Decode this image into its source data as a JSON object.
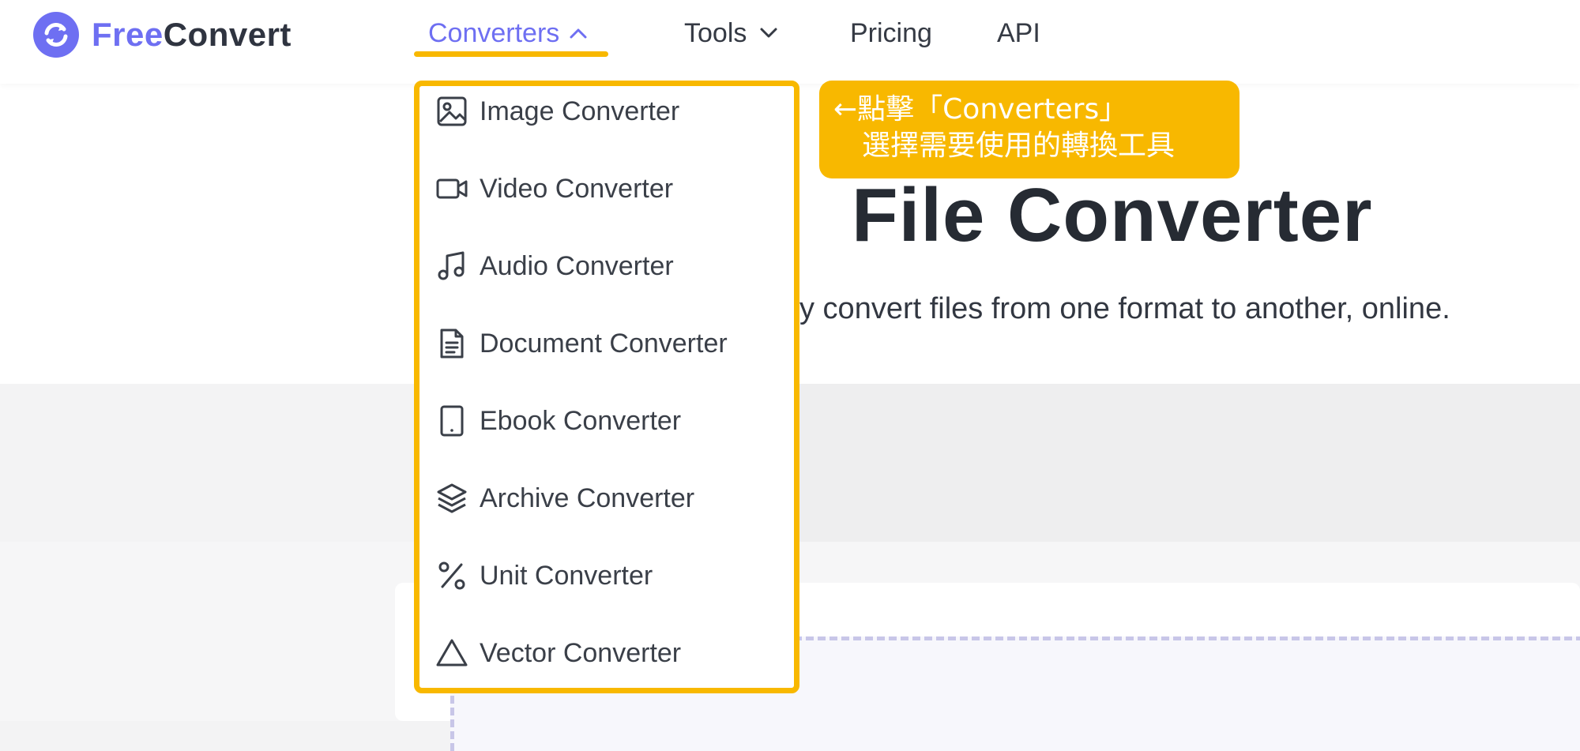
{
  "brand": {
    "free": "Free",
    "convert": "Convert",
    "logo_color": "#6e6ff2"
  },
  "nav": {
    "converters": "Converters",
    "tools": "Tools",
    "pricing": "Pricing",
    "api": "API"
  },
  "dropdown": {
    "items": [
      {
        "label": "Image Converter",
        "icon": "image-icon"
      },
      {
        "label": "Video Converter",
        "icon": "video-icon"
      },
      {
        "label": "Audio Converter",
        "icon": "music-note-icon"
      },
      {
        "label": "Document Converter",
        "icon": "document-icon"
      },
      {
        "label": "Ebook Converter",
        "icon": "tablet-icon"
      },
      {
        "label": "Archive Converter",
        "icon": "layers-icon"
      },
      {
        "label": "Unit Converter",
        "icon": "percent-icon"
      },
      {
        "label": "Vector Converter",
        "icon": "triangle-icon"
      }
    ]
  },
  "hero": {
    "title": "File Converter",
    "subtitle": "y convert files from one format to another, online."
  },
  "annotation": {
    "line1": "←點擊「Converters」",
    "line2": "選擇需要使用的轉換工具"
  },
  "colors": {
    "accent": "#f8b800",
    "brand": "#6e6ff2"
  }
}
